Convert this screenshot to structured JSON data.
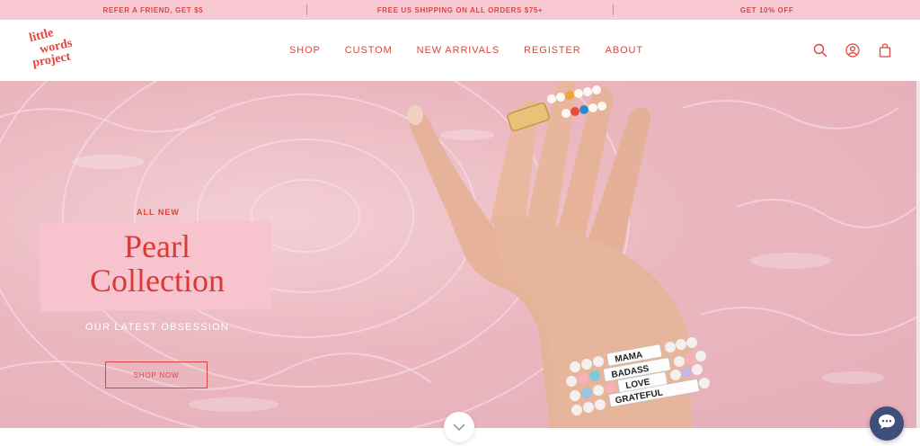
{
  "announcements": [
    "REFER A FRIEND, GET $5",
    "FREE US SHIPPING ON ALL ORDERS $75+",
    "GET 10% OFF"
  ],
  "logo": {
    "line1": "little",
    "line2": "words",
    "line3": "project"
  },
  "nav": [
    "SHOP",
    "CUSTOM",
    "NEW ARRIVALS",
    "REGISTER",
    "ABOUT"
  ],
  "header_icons": [
    "search-icon",
    "account-icon",
    "cart-icon"
  ],
  "hero": {
    "eyebrow": "ALL NEW",
    "title_line1": "Pearl",
    "title_line2": "Collection",
    "subtitle": "OUR LATEST OBSESSION",
    "cta": "SHOP NOW",
    "bracelet_words": [
      "MAMA",
      "BADASS",
      "LOVE",
      "GRATEFUL"
    ]
  },
  "colors": {
    "brand_red": "#d9463f",
    "promo_pink": "#f9c9d3",
    "chat_navy": "#3d4f7a"
  }
}
